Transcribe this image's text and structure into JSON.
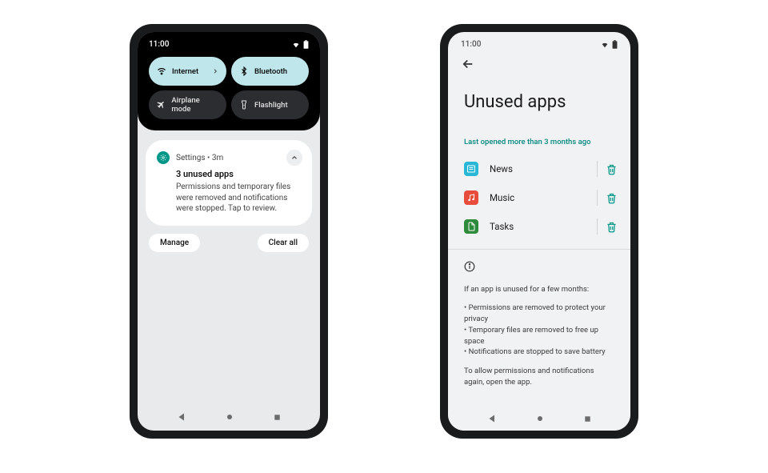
{
  "status_time": "11:00",
  "phone1": {
    "qs": {
      "internet": "Internet",
      "bluetooth": "Bluetooth",
      "airplane": "Airplane mode",
      "flashlight": "Flashlight"
    },
    "notif": {
      "source": "Settings • 3m",
      "title": "3 unused apps",
      "body": "Permissions and temporary files were removed and notifications were stopped. Tap to review."
    },
    "actions": {
      "manage": "Manage",
      "clear_all": "Clear all"
    }
  },
  "phone2": {
    "title": "Unused apps",
    "section_label": "Last opened more than 3 months ago",
    "apps": [
      {
        "name": "News",
        "color": "#28b7d6",
        "glyph": "news"
      },
      {
        "name": "Music",
        "color": "#e84c3d",
        "glyph": "music"
      },
      {
        "name": "Tasks",
        "color": "#2e8b3b",
        "glyph": "tasks"
      }
    ],
    "info": {
      "intro": "If an app is unused for a few months:",
      "bullets": [
        "Permissions are removed to protect your privacy",
        "Temporary files are removed to free up space",
        "Notifications are stopped to save battery"
      ],
      "outro": "To allow permissions and notifications again, open the app."
    }
  },
  "colors": {
    "teal": "#009688"
  }
}
